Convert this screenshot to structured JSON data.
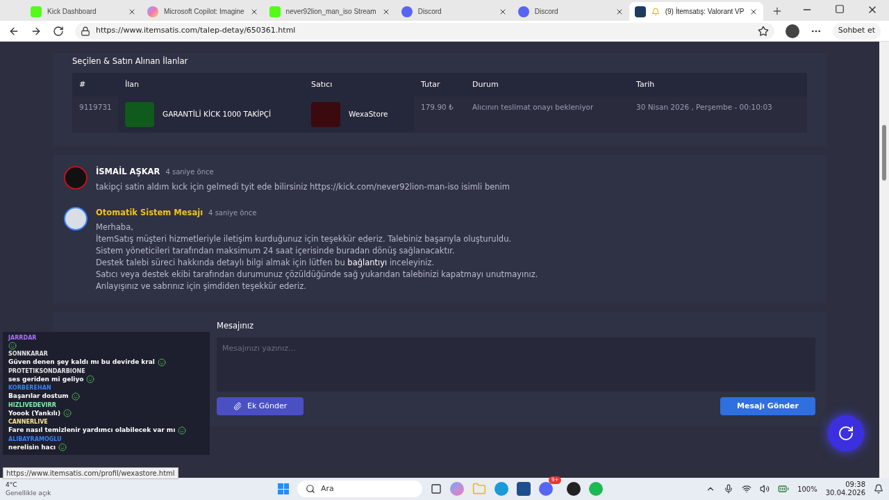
{
  "browser": {
    "tabs": [
      {
        "title": "Kick Dashboard",
        "kind": "kick",
        "selected": false
      },
      {
        "title": "Microsoft Copilot: Imagine",
        "kind": "copilot",
        "selected": false
      },
      {
        "title": "never92lion_man_iso Stream",
        "kind": "kick",
        "selected": false
      },
      {
        "title": "Discord",
        "kind": "discord",
        "selected": false
      },
      {
        "title": "Discord",
        "kind": "discord",
        "selected": false
      },
      {
        "title": "(9) İtemsatış: Valorant VP",
        "kind": "itemsatis",
        "selected": true
      }
    ],
    "url": "https://www.itemsatis.com/talep-detay/650361.html",
    "chat_button": "Sohbet et"
  },
  "page": {
    "section_title": "Seçilen & Satın Alınan İlanlar",
    "columns": [
      "#",
      "İlan",
      "Satıcı",
      "Tutar",
      "Durum",
      "Tarih"
    ],
    "rows": [
      {
        "id": "9119731",
        "listing": "GARANTİLİ KİCK 1000 TAKİPÇİ",
        "seller": "WexaStore",
        "amount": "179.90 ₺",
        "status": "Alıcının teslimat onayı bekleniyor",
        "date": "30 Nisan 2026 , Perşembe - 00:10:03"
      }
    ],
    "messages": [
      {
        "kind": "user",
        "author": "İSMAİL AŞKAR",
        "time": "4 saniye önce",
        "lines": [
          {
            "kind": "text",
            "text": "takipçi satin aldım kıck için gelmedi tyit ede bilirsiniz https://kick.com/never92lion-man-iso isimli benim"
          }
        ]
      },
      {
        "kind": "system",
        "author": "Otomatik Sistem Mesajı",
        "time": "4 saniye önce",
        "lines": [
          {
            "kind": "text",
            "text": "Merhaba,"
          },
          {
            "kind": "text",
            "text": "İtemSatış müşteri hizmetleriyle iletişim kurduğunuz için teşekkür ederiz. Talebiniz başarıyla oluşturuldu."
          },
          {
            "kind": "text",
            "text": "Sistem yöneticileri tarafından maksimum 24 saat içerisinde buradan dönüş sağlanacaktır."
          },
          {
            "kind": "link",
            "before": "Destek talebi süreci hakkında detaylı bilgi almak için lütfen bu",
            "link": "bağlantıyı",
            "after": "inceleyiniz."
          },
          {
            "kind": "text",
            "text": "Satıcı veya destek ekibi tarafından durumunuz çözüldüğünde sağ yukarıdan talebinizi kapatmayı unutmayınız."
          },
          {
            "kind": "text",
            "text": "Anlayışınız ve sabrınız için şimdiden teşekkür ederiz."
          }
        ]
      }
    ],
    "form": {
      "label": "Mesajınız",
      "placeholder": "Mesajınızı yazınız...",
      "attach_button": "Ek Gönder",
      "send_button": "Mesajı Gönder"
    }
  },
  "status_url": "https://www.itemsatis.com/profil/wexastore.html",
  "stream_chat": [
    {
      "user": "JARRDAR",
      "color": "#a970ff"
    },
    {
      "user": "SONNKARAR",
      "text": "Güven denen şey kaldı mı bu devirde kral",
      "color": "#e0e0e0"
    },
    {
      "user": "PROTETIKSONDARBIONE",
      "text": "ses geriden mi geliyo",
      "color": "#e0e0e0"
    },
    {
      "user": "KORBEREHAN",
      "text": "Başarılar dostum",
      "color": "#3b82f6"
    },
    {
      "user": "HIZLIVEDEVIRR",
      "text": "Yoook (Yankılı)",
      "color": "#86efac"
    },
    {
      "user": "CANNERLIVE",
      "text": "Fare nasıl temizlenir yardımcı olabilecek var mı",
      "color": "#fde68a"
    },
    {
      "user": "ALIBAYRAMOGLU",
      "text": "nerelisin hacı",
      "color": "#3b82f6"
    }
  ],
  "taskbar": {
    "weather_temp": "4°C",
    "weather_text": "Genellikle açık",
    "search": "Ara",
    "discord_badge": "9+",
    "battery": "100%",
    "time": "09:38",
    "date": "30.04.2026"
  }
}
